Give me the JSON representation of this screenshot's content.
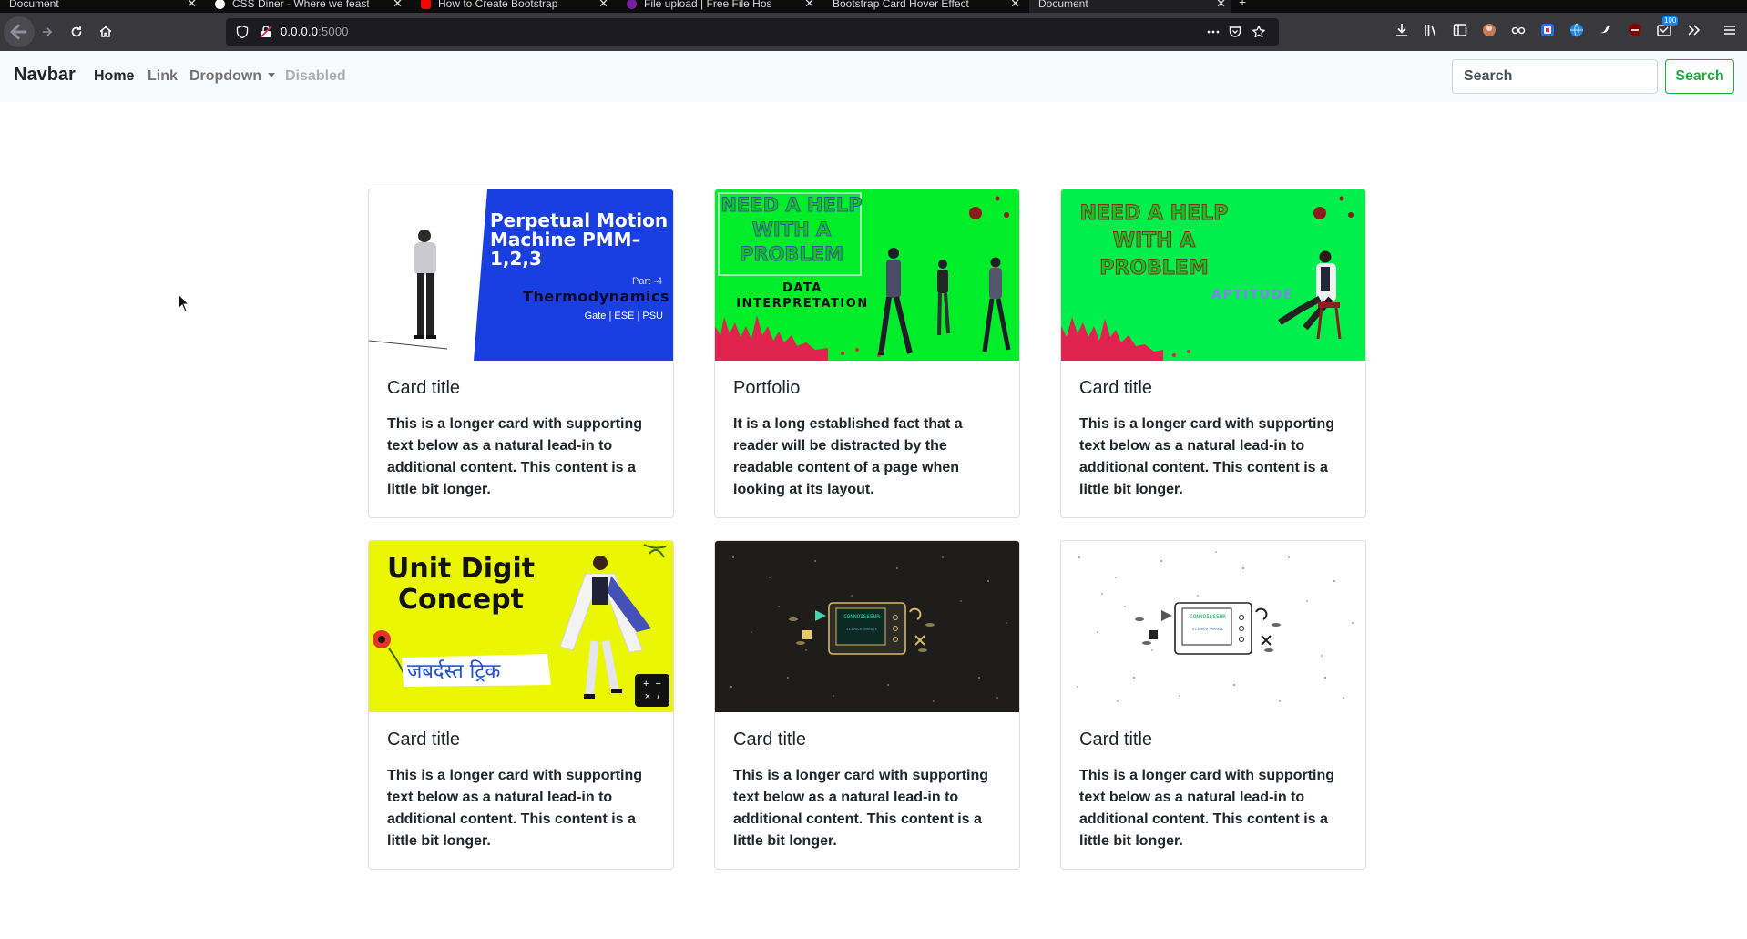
{
  "browser": {
    "tabs": [
      {
        "label": "Document",
        "fav": "#0c0c0d"
      },
      {
        "label": "CSS Diner - Where we feast",
        "fav": "#ffffff"
      },
      {
        "label": "How to Create Bootstrap",
        "fav": "#ff0000"
      },
      {
        "label": "File upload | Free File Hos",
        "fav": "#7b1fa2"
      },
      {
        "label": "Bootstrap Card Hover Effect",
        "fav": "#0c0c0d"
      },
      {
        "label": "Document",
        "fav": "#0c0c0d"
      }
    ],
    "url_host": "0.0.0.0",
    "url_port": ":5000",
    "ext_badge": "100"
  },
  "navbar": {
    "brand": "Navbar",
    "links": [
      "Home",
      "Link",
      "Dropdown",
      "Disabled"
    ],
    "search_placeholder": "Search",
    "search_button": "Search"
  },
  "cards": [
    {
      "title": "Card title",
      "text": "This is a longer card with supporting text below as a natural lead-in to additional content. This content is a little bit longer.",
      "image": {
        "theme": "thermo",
        "line1": "Perpetual Motion",
        "line2": "Machine PMM-",
        "line3": "1,2,3",
        "part": "Part -4",
        "subject": "Thermodynamics",
        "exams": "Gate | ESE | PSU"
      }
    },
    {
      "title": "Portfolio",
      "text": "It is a long established fact that a reader will be distracted by the readable content of a page when looking at its layout.",
      "image": {
        "theme": "green1",
        "line1": "NEED A HELP",
        "line2": "WITH A",
        "line3": "PROBLEM",
        "topic1": "DATA",
        "topic2": "INTERPRETATION"
      }
    },
    {
      "title": "Card title",
      "text": "This is a longer card with supporting text below as a natural lead-in to additional content. This content is a little bit longer.",
      "image": {
        "theme": "green2",
        "line1": "NEED A HELP",
        "line2": "WITH A",
        "line3": "PROBLEM",
        "topic1": "APTITUDE"
      }
    },
    {
      "title": "Card title",
      "text": "This is a longer card with supporting text below as a natural lead-in to additional content. This content is a little bit longer.",
      "image": {
        "theme": "yellow",
        "line1": "Unit Digit",
        "line2": "Concept",
        "hindi": "जबर्दस्त ट्रिक",
        "calc": "+ − × /"
      }
    },
    {
      "title": "Card title",
      "text": "This is a longer card with supporting text below as a natural lead-in to additional content. This content is a little bit longer.",
      "image": {
        "theme": "dark",
        "screen": "CONNOISSEUR",
        "sub": "science events"
      }
    },
    {
      "title": "Card title",
      "text": "This is a longer card with supporting text below as a natural lead-in to additional content. This content is a little bit longer.",
      "image": {
        "theme": "light",
        "screen": "CONNOISSEUR",
        "sub": "science events"
      }
    }
  ]
}
